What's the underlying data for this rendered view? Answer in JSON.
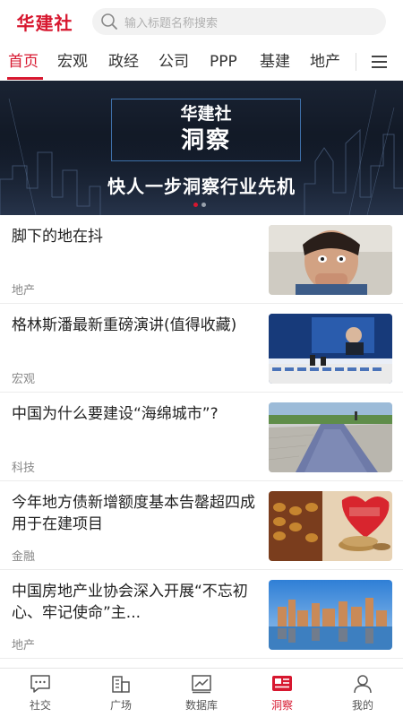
{
  "app": {
    "logo_text": "华建社"
  },
  "search": {
    "placeholder": "输入标题名称搜索"
  },
  "tabs": [
    {
      "label": "首页",
      "active": true
    },
    {
      "label": "宏观"
    },
    {
      "label": "政经"
    },
    {
      "label": "公司"
    },
    {
      "label": "PPP"
    },
    {
      "label": "基建"
    },
    {
      "label": "地产"
    }
  ],
  "banner": {
    "brand": "华建社",
    "title": "洞察",
    "slogan": "快人一步洞察行业先机",
    "slide_count": 2,
    "active_slide": 1
  },
  "news": [
    {
      "title": "脚下的地在抖",
      "category": "地产",
      "image": "frightened-child-photo"
    },
    {
      "title": "格林斯潘最新重磅演讲(值得收藏)",
      "category": "宏观",
      "image": "conference-speech-photo"
    },
    {
      "title": "中国为什么要建设“海绵城市”?",
      "category": "科技",
      "image": "permeable-pavement-photo"
    },
    {
      "title": "今年地方债新增额度基本告罄超四成用于在建项目",
      "category": "金融",
      "image": "abacus-local-debt-photo"
    },
    {
      "title": "中国房地产业协会深入开展“不忘初心、牢记使命”主...",
      "category": "地产",
      "image": "city-skyline-photo"
    }
  ],
  "bottom_nav": [
    {
      "label": "社交",
      "icon": "chat-icon"
    },
    {
      "label": "广场",
      "icon": "building-icon"
    },
    {
      "label": "数据库",
      "icon": "chart-icon"
    },
    {
      "label": "洞察",
      "icon": "insight-icon",
      "active": true
    },
    {
      "label": "我的",
      "icon": "person-icon"
    }
  ],
  "colors": {
    "accent": "#d7172f",
    "text": "#222222",
    "muted": "#888888"
  }
}
